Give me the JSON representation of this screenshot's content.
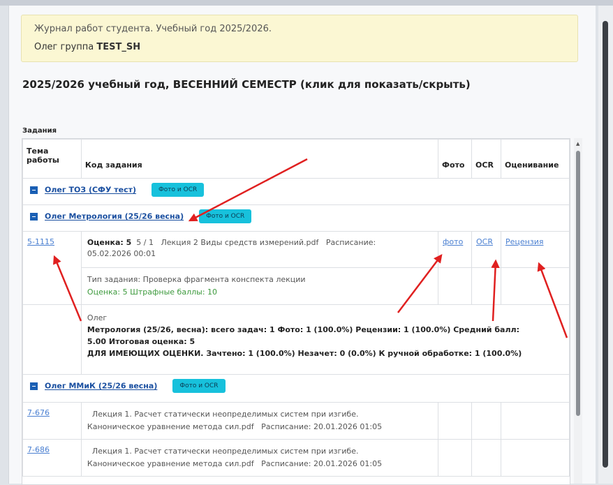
{
  "header": {
    "journal_title": "Журнал работ студента. Учебный год 2025/2026.",
    "student_name": "Олег",
    "group_prefix": "группа",
    "group_name": "TEST_SH"
  },
  "semester_toggle": "2025/2026 учебный год, ВЕСЕННИЙ СЕМЕСТР (клик для показать/скрыть)",
  "tasks_label": "Задания",
  "table": {
    "headers": {
      "topic": "Тема работы",
      "code": "Код задания",
      "photo": "Фото",
      "ocr": "OCR",
      "grading": "Оценивание"
    },
    "group_toz": {
      "label": "Олег   ТОЗ (СФУ тест)",
      "button": "Фото и OCR"
    },
    "group_metro": {
      "label": "Олег   Метрология (25/26 весна)",
      "button": "Фото и OCR"
    },
    "task1": {
      "link": "5-1115",
      "grade_label": "Оценка: 5",
      "grade_fraction": "5 / 1",
      "file": "Лекция 2 Виды средств измерений.pdf",
      "schedule_label": "Расписание:",
      "schedule_value": "05.02.2026 00:01",
      "photo_link": "фото",
      "ocr_link": "OCR",
      "review_link": "Рецензия",
      "type_line": "Тип задания: Проверка фрагмента конспекта лекции",
      "score_line": "Оценка: 5 Штрафные баллы: 10"
    },
    "summary": {
      "name": "Олег",
      "line1": "Метрология (25/26, весна): всего задач: 1   Фото: 1   (100.0%)   Рецензии: 1   (100.0%)   Средний балл:",
      "line2": "5.00   Итоговая оценка: 5",
      "line3": "ДЛЯ ИМЕЮЩИХ ОЦЕНКИ.   Зачтено: 1   (100.0%) Незачет: 0   (0.0%) К ручной обработке: 1   (100.0%)"
    },
    "group_mmik": {
      "label": "Олег   ММиК (25/26 весна)",
      "button": "Фото и OCR"
    },
    "task2": {
      "link": "7-676",
      "title": "Лекция 1. Расчет статически неопределимых систем при изгибе.",
      "file": "Каноническое уравнение метода сил.pdf",
      "schedule": "Расписание: 20.01.2026 01:05"
    },
    "task3": {
      "link": "7-686",
      "title": "Лекция 1. Расчет статически неопределимых систем при изгибе.",
      "file": "Каноническое уравнение метода сил.pdf",
      "schedule": "Расписание: 20.01.2026 01:05"
    }
  },
  "colors": {
    "accent_button": "#17c1dc",
    "notice_bg": "#fbf7d3",
    "link": "#1a4fa0",
    "arrow": "#e02020"
  }
}
